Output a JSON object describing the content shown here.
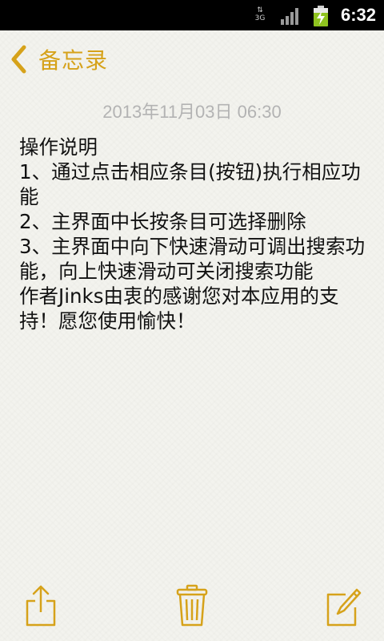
{
  "status_bar": {
    "network": "3G",
    "time": "6:32"
  },
  "nav": {
    "back_label": "备忘录",
    "accent_color": "#d6a21a"
  },
  "note": {
    "timestamp": "2013年11月03日 06:30",
    "content": "操作说明\n1、通过点击相应条目(按钮)执行相应功能\n2、主界面中长按条目可选择删除\n3、主界面中向下快速滑动可调出搜索功能，向上快速滑动可关闭搜索功能\n作者Jinks由衷的感谢您对本应用的支持！愿您使用愉快！"
  },
  "toolbar": {
    "icons": [
      "share-icon",
      "trash-icon",
      "compose-icon"
    ]
  }
}
